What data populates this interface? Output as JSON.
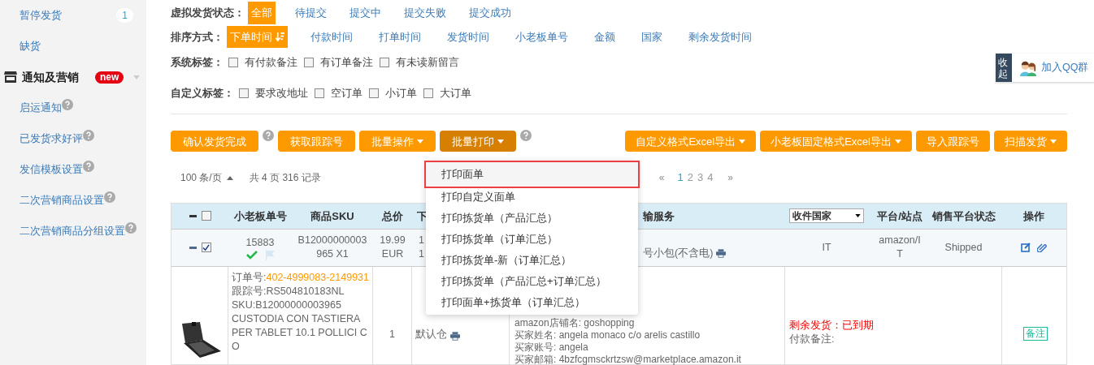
{
  "sidebar": {
    "items": [
      {
        "label": "暂停发货",
        "badge": "1"
      },
      {
        "label": "缺货"
      }
    ],
    "section": {
      "label": "通知及营销",
      "badge": "new"
    },
    "sub_items": [
      {
        "label": "启运通知"
      },
      {
        "label": "已发货求好评"
      },
      {
        "label": "发信模板设置"
      },
      {
        "label": "二次营销商品设置"
      },
      {
        "label": "二次营销商品分组设置"
      }
    ]
  },
  "filters": {
    "status": {
      "label": "虚拟发货状态：",
      "options": [
        {
          "label": "全部",
          "selected": true
        },
        {
          "label": "待提交",
          "selected": false
        },
        {
          "label": "提交中",
          "selected": false
        },
        {
          "label": "提交失败",
          "selected": false
        },
        {
          "label": "提交成功",
          "selected": false
        }
      ]
    },
    "sort": {
      "label": "排序方式：",
      "options": [
        {
          "label": "下单时间",
          "selected": true
        },
        {
          "label": "付款时间",
          "selected": false
        },
        {
          "label": "打单时间",
          "selected": false
        },
        {
          "label": "发货时间",
          "selected": false
        },
        {
          "label": "小老板单号",
          "selected": false
        },
        {
          "label": "金额",
          "selected": false
        },
        {
          "label": "国家",
          "selected": false
        },
        {
          "label": "剩余发货时间",
          "selected": false
        }
      ]
    },
    "system_tags": {
      "label": "系统标签：",
      "tags": [
        {
          "label": "有付款备注",
          "checked": false
        },
        {
          "label": "有订单备注",
          "checked": false
        },
        {
          "label": "有未读新留言",
          "checked": false
        }
      ]
    },
    "custom_tags": {
      "label": "自定义标签：",
      "tags": [
        {
          "label": "要求改地址",
          "checked": false
        },
        {
          "label": "空订单",
          "checked": false
        },
        {
          "label": "小订单",
          "checked": false
        },
        {
          "label": "大订单",
          "checked": false
        }
      ]
    }
  },
  "toolbar_left": [
    {
      "label": "确认发货完成",
      "menu": false,
      "help": true,
      "active": false
    },
    {
      "label": "获取跟踪号",
      "menu": false,
      "help": false,
      "active": false
    },
    {
      "label": "批量操作",
      "menu": true,
      "help": false,
      "active": false
    },
    {
      "label": "批量打印",
      "menu": true,
      "help": true,
      "active": true
    }
  ],
  "toolbar_right": [
    {
      "label": "自定义格式Excel导出",
      "menu": true
    },
    {
      "label": "小老板固定格式Excel导出",
      "menu": true
    },
    {
      "label": "导入跟踪号",
      "menu": false
    },
    {
      "label": "扫描发货",
      "menu": true
    }
  ],
  "pager": {
    "per_page": "100 条/页",
    "total": "共 4 页 316 记录",
    "prev": "«",
    "next": "»",
    "pages": [
      {
        "label": "1",
        "selected": true
      },
      {
        "label": "2",
        "selected": false
      },
      {
        "label": "3",
        "selected": false
      },
      {
        "label": "4",
        "selected": false
      }
    ]
  },
  "table": {
    "header_checked": false,
    "columns": [
      "小老板单号",
      "商品SKU",
      "总价",
      "下",
      "输服务",
      "收件国家",
      "平台/站点",
      "销售平台状态",
      "操作"
    ],
    "summary": {
      "checked": true,
      "order_no": "15883",
      "sku": "B12000000003 965 X1",
      "price": "19.99 EUR",
      "date_1": "1",
      "date_2": "1",
      "shipping": "号小包(不含电)",
      "country": "IT",
      "platform": "amazon/I T",
      "status": "Shipped"
    },
    "detail": {
      "order_label": "订单号:",
      "order_value": "402-4999083-2149931",
      "tracking": "跟踪号:RS504810183NL",
      "sku": "SKU:B12000000003965",
      "title": "CUSTODIA CON TASTIERA PER TABLET 10.1 POLLICI CO",
      "qty": "1",
      "warehouse": "默认仓",
      "buyer": [
        "amazon店铺名: goshopping",
        "买家姓名: angela monaco c/o arelis castillo",
        "买家账号: angela",
        "买家邮箱: 4bzfcgmsckrtzsw@marketplace.amazon.it"
      ],
      "remaining": "剩余发货：已到期",
      "payment_note": "付款备注:",
      "note_button": "备注"
    }
  },
  "print_menu": [
    {
      "label": "打印面单",
      "selected": true
    },
    {
      "label": "打印自定义面单",
      "selected": false
    },
    {
      "label": "打印拣货单（产品汇总）",
      "selected": false
    },
    {
      "label": "打印拣货单（订单汇总）",
      "selected": false
    },
    {
      "label": "打印拣货单-新（订单汇总）",
      "selected": false
    },
    {
      "label": "打印拣货单（产品汇总+订单汇总）",
      "selected": false
    },
    {
      "label": "打印面单+拣货单（订单汇总）",
      "selected": false
    }
  ],
  "qq_widget": {
    "collapse": "收起",
    "label": "加入QQ群"
  }
}
